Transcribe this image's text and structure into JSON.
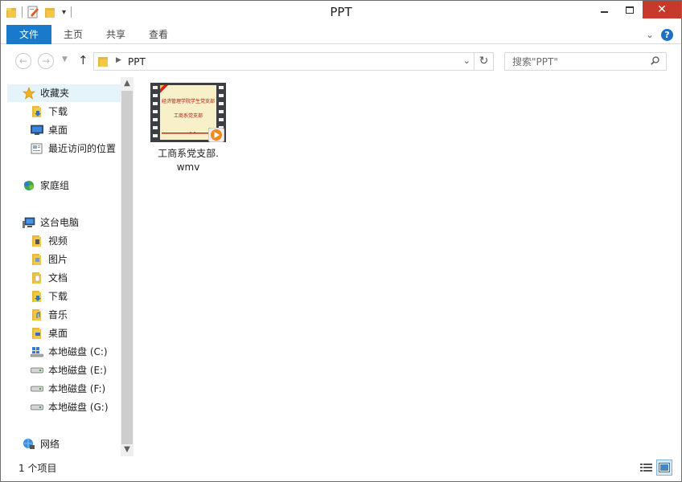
{
  "window": {
    "title": "PPT"
  },
  "ribbon": {
    "tabs": [
      {
        "label": "文件"
      },
      {
        "label": "主页"
      },
      {
        "label": "共享"
      },
      {
        "label": "查看"
      }
    ],
    "help_label": "?"
  },
  "address": {
    "path": "PPT"
  },
  "search": {
    "placeholder": "搜索\"PPT\""
  },
  "nav": {
    "favorites": {
      "label": "收藏夹",
      "items": [
        {
          "label": "下载",
          "icon": "download-folder-icon"
        },
        {
          "label": "桌面",
          "icon": "desktop-icon"
        },
        {
          "label": "最近访问的位置",
          "icon": "recent-places-icon"
        }
      ]
    },
    "homegroup": {
      "label": "家庭组"
    },
    "thispc": {
      "label": "这台电脑",
      "items": [
        {
          "label": "视频",
          "icon": "videos-folder-icon"
        },
        {
          "label": "图片",
          "icon": "pictures-folder-icon"
        },
        {
          "label": "文档",
          "icon": "documents-folder-icon"
        },
        {
          "label": "下载",
          "icon": "download-folder-icon"
        },
        {
          "label": "音乐",
          "icon": "music-folder-icon"
        },
        {
          "label": "桌面",
          "icon": "desktop-folder-icon"
        },
        {
          "label": "本地磁盘 (C:)",
          "icon": "system-drive-icon"
        },
        {
          "label": "本地磁盘 (E:)",
          "icon": "drive-icon"
        },
        {
          "label": "本地磁盘 (F:)",
          "icon": "drive-icon"
        },
        {
          "label": "本地磁盘 (G:)",
          "icon": "drive-icon"
        }
      ]
    },
    "network": {
      "label": "网络"
    }
  },
  "files": [
    {
      "name_line1": "工商系党支部.",
      "name_line2": "wmv",
      "thumb_title": "经济管理学院学生党支部",
      "thumb_subtitle": "工商系党支部",
      "icon": "video-file-icon"
    }
  ],
  "status": {
    "item_count": "1 个项目"
  },
  "colors": {
    "file_tab": "#1979ca",
    "close_button": "#c7392b",
    "selected_nav": "#e5f3fb"
  }
}
